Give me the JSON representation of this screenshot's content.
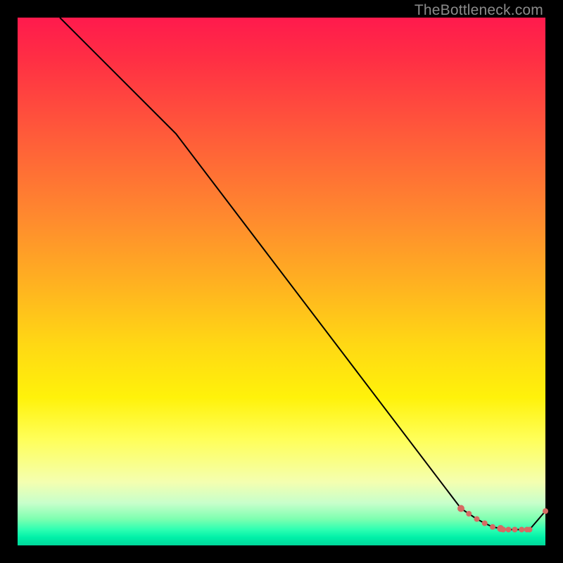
{
  "watermark": "TheBottleneck.com",
  "colors": {
    "background": "#000000",
    "line": "#000000",
    "marker": "#d66a63",
    "gradient_top": "#ff1a4d",
    "gradient_bottom": "#00d89a"
  },
  "chart_data": {
    "type": "line",
    "title": "",
    "xlabel": "",
    "ylabel": "",
    "xlim": [
      0,
      100
    ],
    "ylim": [
      0,
      100
    ],
    "grid": false,
    "legend": false,
    "series": [
      {
        "name": "curve",
        "x": [
          8,
          30,
          84,
          85.5,
          87,
          88.5,
          90,
          91.5,
          92,
          93,
          94.2,
          95.5,
          96.5,
          97,
          100
        ],
        "y": [
          100,
          78,
          7,
          6,
          5,
          4.2,
          3.5,
          3.2,
          3,
          3,
          3,
          3,
          3,
          3,
          6.5
        ]
      }
    ],
    "markers": {
      "name": "highlight-points",
      "x": [
        84,
        85.5,
        87,
        88.5,
        90,
        91.5,
        92,
        93,
        94.2,
        95.5,
        96.5,
        97,
        100
      ],
      "y": [
        7,
        6,
        5,
        4.2,
        3.5,
        3.2,
        3,
        3,
        3,
        3,
        3,
        3,
        6.5
      ],
      "sizes": [
        5,
        4,
        4,
        4,
        4,
        5,
        4,
        4,
        4,
        4,
        4,
        4,
        4
      ]
    }
  }
}
